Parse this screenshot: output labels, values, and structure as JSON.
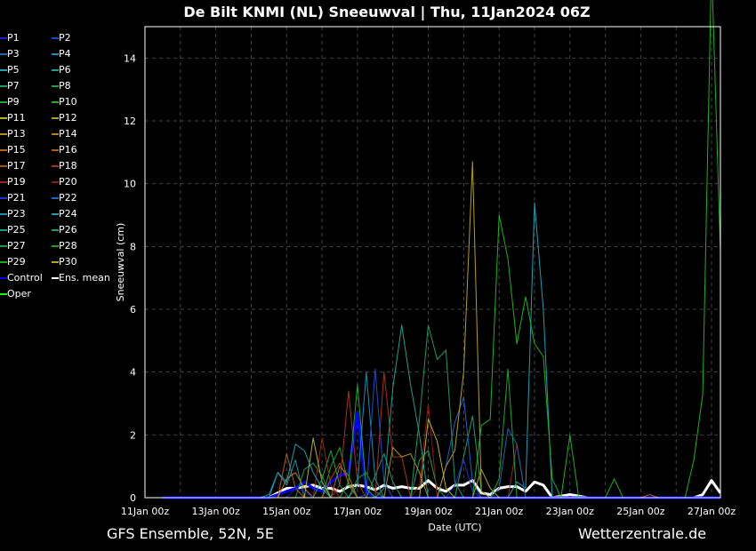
{
  "title": "De Bilt KNMI  (NL)  Sneeuwval | Thu, 11Jan2024 06Z",
  "footer": {
    "left": "GFS Ensemble, 52N, 5E",
    "right": "Wetterzentrale.de"
  },
  "chart_data": {
    "type": "line",
    "xlabel": "Date (UTC)",
    "ylabel": "Sneeuwval (cm)",
    "x_unit": "6-hour steps from 11Jan 00z",
    "x_range_steps": [
      0,
      65
    ],
    "ylim": [
      0,
      15
    ],
    "x_ticks": [
      {
        "step": 0,
        "label": "11Jan 00z"
      },
      {
        "step": 8,
        "label": "13Jan 00z"
      },
      {
        "step": 16,
        "label": "15Jan 00z"
      },
      {
        "step": 24,
        "label": "17Jan 00z"
      },
      {
        "step": 32,
        "label": "19Jan 00z"
      },
      {
        "step": 40,
        "label": "21Jan 00z"
      },
      {
        "step": 48,
        "label": "23Jan 00z"
      },
      {
        "step": 56,
        "label": "25Jan 00z"
      },
      {
        "step": 64,
        "label": "27Jan 00z"
      }
    ],
    "y_ticks": [
      0,
      2,
      4,
      6,
      8,
      10,
      12,
      14
    ],
    "grid": true,
    "legend_placement": "left-outside",
    "series_start_step": 2,
    "series_end_step": 65,
    "series": [
      {
        "name": "P1",
        "color": "#1a1acc",
        "points": [
          [
            17,
            0.3
          ],
          [
            18,
            0.2
          ]
        ]
      },
      {
        "name": "P2",
        "color": "#1a4ccc",
        "points": [
          [
            25,
            0.1
          ],
          [
            26,
            4.1
          ],
          [
            27,
            0.5
          ]
        ]
      },
      {
        "name": "P3",
        "color": "#1a66b3",
        "points": [
          [
            40,
            0.3
          ],
          [
            41,
            2.2
          ],
          [
            42,
            1.7
          ],
          [
            43,
            0
          ]
        ]
      },
      {
        "name": "P4",
        "color": "#1a8cb3",
        "points": [
          [
            24,
            0.4
          ],
          [
            25,
            4.0
          ],
          [
            26,
            0.6
          ]
        ]
      },
      {
        "name": "P5",
        "color": "#1aa0b3",
        "points": [
          [
            15,
            0.8
          ],
          [
            16,
            0.5
          ],
          [
            17,
            1.7
          ],
          [
            18,
            1.5
          ],
          [
            19,
            0.8
          ],
          [
            20,
            0.3
          ]
        ]
      },
      {
        "name": "P6",
        "color": "#1aa08c",
        "points": [
          [
            27,
            0.3
          ],
          [
            28,
            3.5
          ],
          [
            29,
            5.5
          ],
          [
            30,
            3.6
          ],
          [
            31,
            2.0
          ]
        ]
      },
      {
        "name": "P7",
        "color": "#1a9966",
        "points": [
          [
            31,
            2.5
          ],
          [
            32,
            5.5
          ],
          [
            33,
            4.4
          ],
          [
            34,
            4.7
          ],
          [
            35,
            0.5
          ]
        ]
      },
      {
        "name": "P8",
        "color": "#1aa04c",
        "points": [
          [
            20,
            0.6
          ],
          [
            21,
            1.5
          ],
          [
            22,
            0.4
          ]
        ]
      },
      {
        "name": "P9",
        "color": "#1aa826",
        "points": [
          [
            23,
            0.5
          ],
          [
            24,
            3.6
          ],
          [
            25,
            0.3
          ],
          [
            40,
            0.6
          ],
          [
            41,
            4.1
          ],
          [
            42,
            0
          ]
        ]
      },
      {
        "name": "P10",
        "color": "#1ab31a",
        "points": [
          [
            38,
            2.3
          ],
          [
            39,
            2.5
          ],
          [
            40,
            9.0
          ],
          [
            41,
            7.6
          ],
          [
            42,
            4.9
          ],
          [
            43,
            6.4
          ],
          [
            44,
            4.9
          ],
          [
            45,
            4.5
          ],
          [
            46,
            0.6
          ],
          [
            47,
            0
          ],
          [
            48,
            2.0
          ],
          [
            49,
            0
          ],
          [
            52,
            0
          ],
          [
            53,
            0.6
          ],
          [
            54,
            0
          ],
          [
            62,
            1.2
          ],
          [
            63,
            3.3
          ],
          [
            64,
            17
          ],
          [
            65,
            7.8
          ]
        ]
      },
      {
        "name": "P11",
        "color": "#b3b31a",
        "points": [
          [
            19,
            1.9
          ],
          [
            20,
            0.5
          ],
          [
            32,
            2.5
          ],
          [
            33,
            1.8
          ],
          [
            34,
            0.3
          ]
        ]
      },
      {
        "name": "P12",
        "color": "#b3a01a",
        "points": [
          [
            34,
            1.0
          ],
          [
            35,
            1.5
          ],
          [
            36,
            4.0
          ],
          [
            37,
            10.7
          ],
          [
            38,
            0.2
          ]
        ]
      },
      {
        "name": "P13",
        "color": "#b38c1a",
        "points": [
          [
            28,
            1.6
          ],
          [
            29,
            1.3
          ],
          [
            30,
            1.4
          ],
          [
            31,
            0.8
          ]
        ]
      },
      {
        "name": "P14",
        "color": "#b3801a",
        "points": [
          [
            16,
            0.6
          ],
          [
            17,
            0.8
          ],
          [
            18,
            0.3
          ]
        ]
      },
      {
        "name": "P15",
        "color": "#b3661a",
        "points": [
          [
            22,
            1.0
          ],
          [
            23,
            0.7
          ]
        ]
      },
      {
        "name": "P16",
        "color": "#b35a1a",
        "points": [
          [
            16,
            1.4
          ],
          [
            17,
            0.3
          ],
          [
            56,
            0
          ],
          [
            57,
            0.1
          ],
          [
            58,
            0
          ]
        ]
      },
      {
        "name": "P17",
        "color": "#a64d1a",
        "points": [
          [
            21,
            0.6
          ],
          [
            22,
            1.1
          ],
          [
            23,
            0.5
          ]
        ]
      },
      {
        "name": "P18",
        "color": "#a6331a",
        "points": [
          [
            22,
            0.4
          ],
          [
            23,
            3.4
          ],
          [
            24,
            0.5
          ],
          [
            27,
            4.0
          ],
          [
            28,
            1.3
          ],
          [
            29,
            1.3
          ],
          [
            30,
            0
          ]
        ]
      },
      {
        "name": "P19",
        "color": "#99261a",
        "points": [
          [
            20,
            1.9
          ],
          [
            21,
            0.4
          ],
          [
            42,
            1.7
          ],
          [
            43,
            0
          ]
        ]
      },
      {
        "name": "P20",
        "color": "#8c1a1a",
        "points": [
          [
            31,
            0.4
          ],
          [
            32,
            3.0
          ],
          [
            33,
            0
          ]
        ]
      },
      {
        "name": "P21",
        "color": "#1a33cc",
        "points": [
          [
            35,
            0.4
          ],
          [
            36,
            1.2
          ],
          [
            37,
            0.2
          ]
        ]
      },
      {
        "name": "P22",
        "color": "#1a66cc",
        "points": [
          [
            34,
            1.0
          ],
          [
            35,
            2.4
          ],
          [
            36,
            3.2
          ],
          [
            37,
            0.5
          ]
        ]
      },
      {
        "name": "P23",
        "color": "#1a8cb3",
        "points": [
          [
            14,
            0.1
          ],
          [
            15,
            0.8
          ],
          [
            16,
            0.4
          ],
          [
            17,
            1.2
          ]
        ]
      },
      {
        "name": "P24",
        "color": "#1aa0b3",
        "points": [
          [
            42,
            0.5
          ],
          [
            43,
            0.3
          ],
          [
            44,
            9.4
          ],
          [
            45,
            6.0
          ],
          [
            46,
            0
          ]
        ]
      },
      {
        "name": "P25",
        "color": "#1a9980",
        "points": [
          [
            26,
            0.7
          ],
          [
            27,
            1.4
          ],
          [
            28,
            0.5
          ]
        ]
      },
      {
        "name": "P26",
        "color": "#1aa066",
        "points": [
          [
            31,
            1.2
          ],
          [
            32,
            1.5
          ],
          [
            33,
            0.3
          ],
          [
            36,
            1.3
          ],
          [
            37,
            2.6
          ],
          [
            38,
            0.2
          ]
        ]
      },
      {
        "name": "P27",
        "color": "#1a9940",
        "points": [
          [
            18,
            0.9
          ],
          [
            19,
            1.1
          ],
          [
            20,
            0.7
          ]
        ]
      },
      {
        "name": "P28",
        "color": "#1aa026",
        "points": [
          [
            24,
            0.6
          ],
          [
            25,
            0.8
          ],
          [
            26,
            0.2
          ]
        ]
      },
      {
        "name": "P29",
        "color": "#1aa81a",
        "points": [
          [
            21,
            1.0
          ],
          [
            22,
            1.6
          ],
          [
            23,
            0.4
          ]
        ]
      },
      {
        "name": "P30",
        "color": "#b3a61a",
        "points": [
          [
            38,
            0.9
          ],
          [
            39,
            0.3
          ]
        ]
      },
      {
        "name": "Control",
        "color": "#0000ff",
        "width": 3,
        "points": [
          [
            15,
            0.1
          ],
          [
            16,
            0.2
          ],
          [
            17,
            0.3
          ],
          [
            18,
            0.5
          ],
          [
            19,
            0.3
          ],
          [
            20,
            0.2
          ],
          [
            21,
            0.5
          ],
          [
            22,
            0.7
          ],
          [
            23,
            0.8
          ],
          [
            24,
            2.7
          ],
          [
            25,
            0.2
          ],
          [
            26,
            0
          ]
        ]
      },
      {
        "name": "Ens. mean",
        "color": "#ffffff",
        "width": 3,
        "points": [
          [
            14,
            0
          ],
          [
            15,
            0.15
          ],
          [
            16,
            0.3
          ],
          [
            17,
            0.3
          ],
          [
            18,
            0.35
          ],
          [
            19,
            0.4
          ],
          [
            20,
            0.3
          ],
          [
            21,
            0.3
          ],
          [
            22,
            0.2
          ],
          [
            23,
            0.35
          ],
          [
            24,
            0.4
          ],
          [
            25,
            0.35
          ],
          [
            26,
            0.25
          ],
          [
            27,
            0.4
          ],
          [
            28,
            0.3
          ],
          [
            29,
            0.35
          ],
          [
            30,
            0.3
          ],
          [
            31,
            0.3
          ],
          [
            32,
            0.55
          ],
          [
            33,
            0.3
          ],
          [
            34,
            0.2
          ],
          [
            35,
            0.4
          ],
          [
            36,
            0.4
          ],
          [
            37,
            0.55
          ],
          [
            38,
            0.15
          ],
          [
            39,
            0.1
          ],
          [
            40,
            0.3
          ],
          [
            41,
            0.35
          ],
          [
            42,
            0.35
          ],
          [
            43,
            0.2
          ],
          [
            44,
            0.5
          ],
          [
            45,
            0.4
          ],
          [
            46,
            0
          ],
          [
            47,
            0.05
          ],
          [
            48,
            0.1
          ],
          [
            49,
            0.05
          ],
          [
            50,
            0
          ],
          [
            63,
            0.1
          ],
          [
            64,
            0.55
          ],
          [
            65,
            0.15
          ]
        ]
      },
      {
        "name": "Oper",
        "color": "#00ff00",
        "points": []
      }
    ]
  }
}
